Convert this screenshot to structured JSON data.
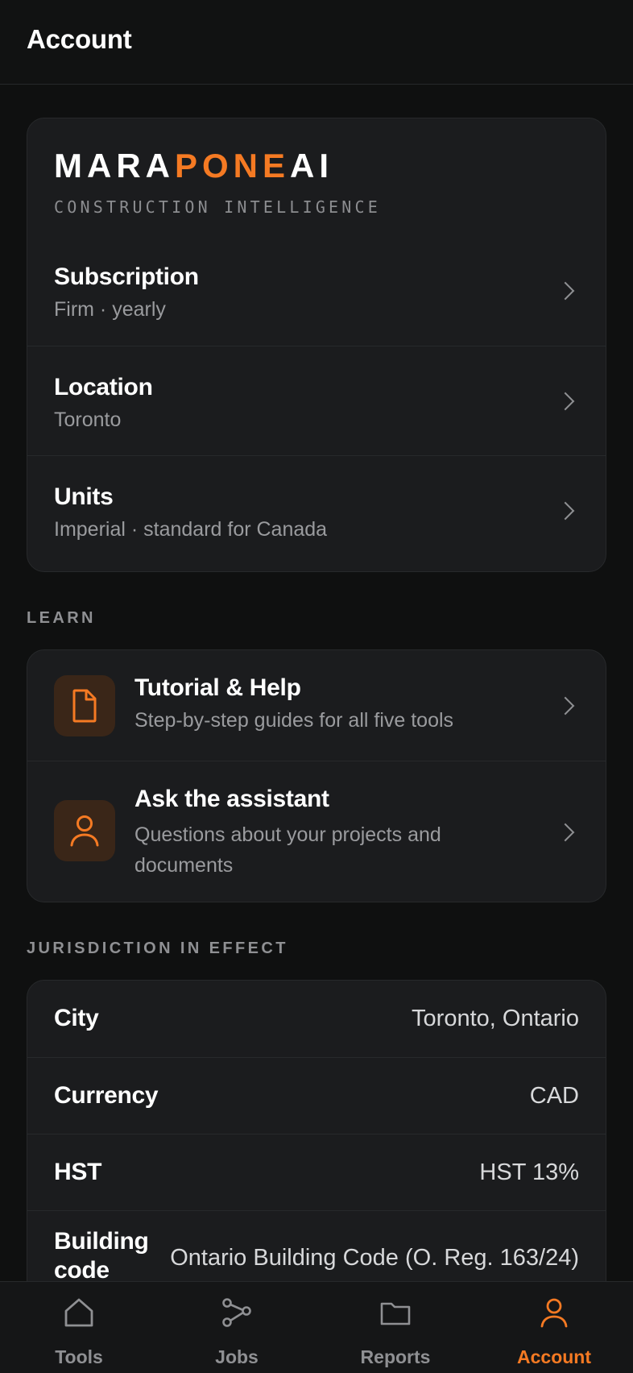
{
  "header": {
    "title": "Account"
  },
  "brand": {
    "logo_part1": "MARA",
    "logo_part2": "PONE",
    "logo_part3": "AI",
    "tagline": "CONSTRUCTION INTELLIGENCE",
    "accent_color": "#f57a23"
  },
  "settings": [
    {
      "title": "Subscription",
      "subtitle": "Firm · yearly"
    },
    {
      "title": "Location",
      "subtitle": "Toronto"
    },
    {
      "title": "Units",
      "subtitle": "Imperial · standard for Canada"
    }
  ],
  "learn": {
    "label": "LEARN",
    "items": [
      {
        "title": "Tutorial & Help",
        "subtitle": "Step-by-step guides for all five tools",
        "icon": "document-icon"
      },
      {
        "title": "Ask the assistant",
        "subtitle": "Questions about your projects and documents",
        "icon": "person-icon"
      }
    ]
  },
  "jurisdiction": {
    "label": "JURISDICTION IN EFFECT",
    "rows": [
      {
        "key": "City",
        "value": "Toronto, Ontario"
      },
      {
        "key": "Currency",
        "value": "CAD"
      },
      {
        "key": "HST",
        "value": "HST 13%"
      },
      {
        "key": "Building code",
        "value": "Ontario Building Code (O. Reg. 163/24)"
      }
    ]
  },
  "nav": {
    "items": [
      {
        "label": "Tools",
        "icon": "home-icon"
      },
      {
        "label": "Jobs",
        "icon": "share-nodes-icon"
      },
      {
        "label": "Reports",
        "icon": "folder-icon"
      },
      {
        "label": "Account",
        "icon": "person-icon",
        "active": true
      }
    ]
  }
}
